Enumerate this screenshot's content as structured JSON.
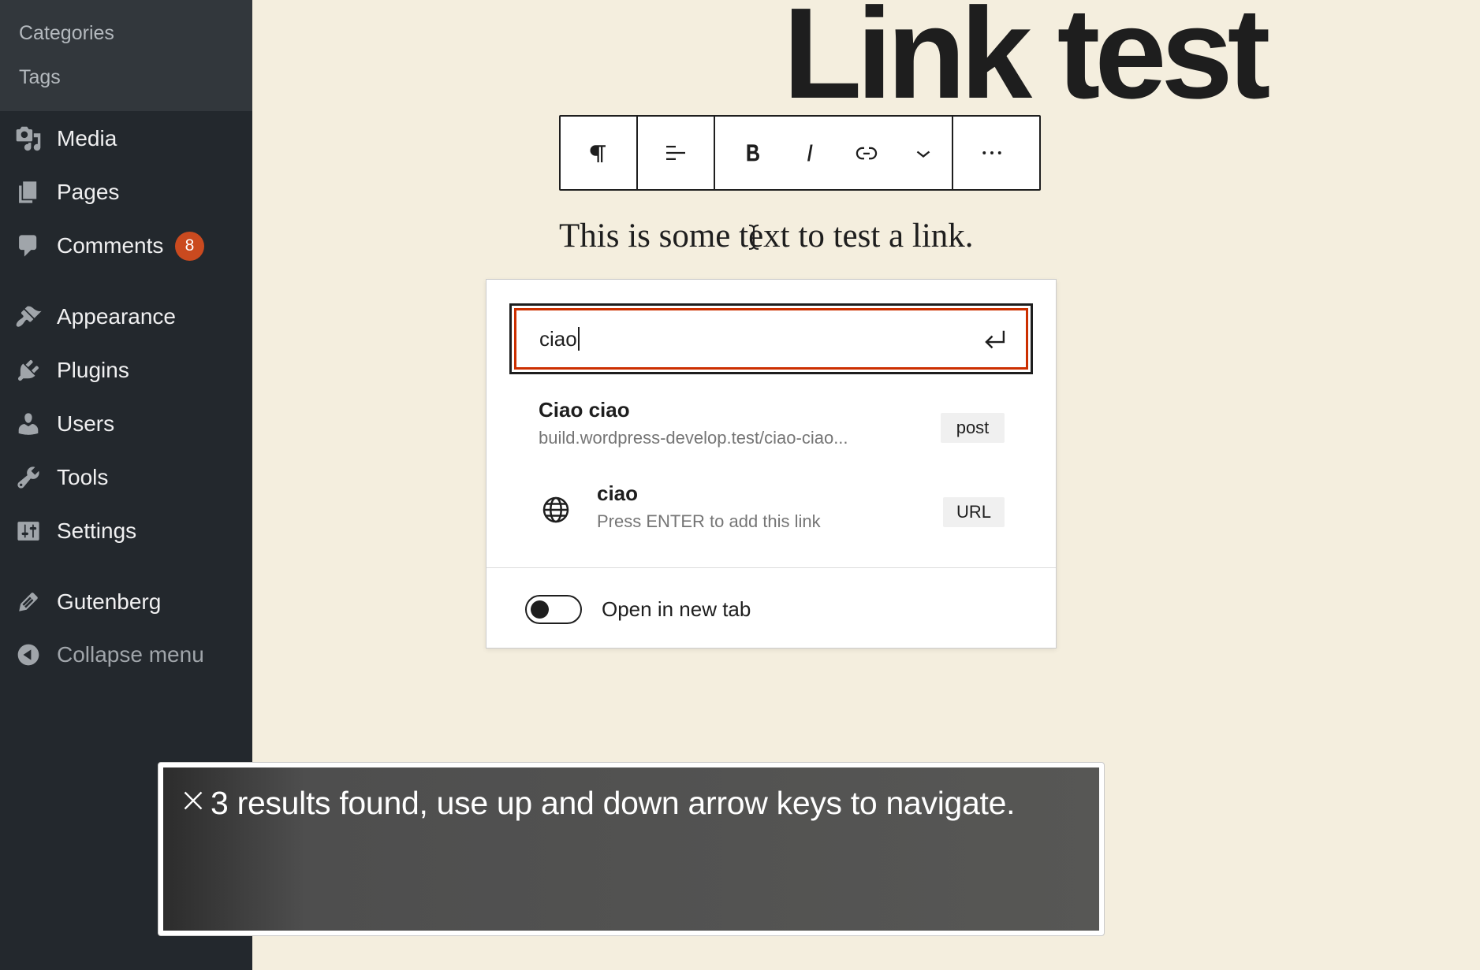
{
  "sidebar": {
    "submenu": [
      {
        "label": "Categories"
      },
      {
        "label": "Tags"
      }
    ],
    "items": [
      {
        "label": "Media",
        "icon": "media-icon"
      },
      {
        "label": "Pages",
        "icon": "pages-icon"
      },
      {
        "label": "Comments",
        "icon": "comments-icon",
        "badge": "8"
      },
      {
        "label": "Appearance",
        "icon": "appearance-icon"
      },
      {
        "label": "Plugins",
        "icon": "plugins-icon"
      },
      {
        "label": "Users",
        "icon": "users-icon"
      },
      {
        "label": "Tools",
        "icon": "tools-icon"
      },
      {
        "label": "Settings",
        "icon": "settings-icon"
      },
      {
        "label": "Gutenberg",
        "icon": "gutenberg-icon"
      },
      {
        "label": "Collapse menu",
        "icon": "collapse-icon"
      }
    ]
  },
  "editor": {
    "title": "Link test",
    "paragraph": "This is some text to test a link.",
    "toolbar": [
      "paragraph-icon",
      "align-icon",
      "bold-icon",
      "italic-icon",
      "link-icon",
      "chevron-down-icon",
      "more-options-icon"
    ]
  },
  "link_popover": {
    "search_value": "ciao",
    "results": [
      {
        "title": "Ciao ciao",
        "subtitle": "build.wordpress-develop.test/ciao-ciao...",
        "tag": "post"
      },
      {
        "title": "ciao",
        "subtitle": "Press ENTER to add this link",
        "tag": "URL",
        "icon": "globe-icon"
      }
    ],
    "open_new_tab_label": "Open in new tab",
    "open_new_tab_enabled": false
  },
  "notice": {
    "text": "3 results found, use up and down arrow keys to navigate."
  },
  "colors": {
    "sidebar_bg": "#23282d",
    "submenu_bg": "#32373c",
    "editor_bg": "#f4eede",
    "badge_bg": "#ca4a1f",
    "focus_ring": "#cc2f00"
  }
}
